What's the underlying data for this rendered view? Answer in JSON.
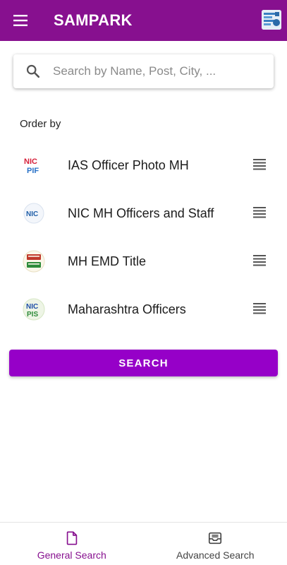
{
  "header": {
    "title": "SAMPARK",
    "menu_icon": "hamburger-menu-icon",
    "logo_icon": "sampark-logo-icon",
    "background_color": "#87108f"
  },
  "search": {
    "placeholder": "Search by Name, Post, City, ...",
    "value": "",
    "icon": "search-icon"
  },
  "order": {
    "label": "Order by",
    "items": [
      {
        "label": "IAS Officer Photo MH",
        "icon": "nic-pif-logo-icon"
      },
      {
        "label": "NIC MH Officers and Staff",
        "icon": "nic-logo-icon"
      },
      {
        "label": "MH EMD Title",
        "icon": "mahapar-logo-icon"
      },
      {
        "label": "Maharashtra Officers",
        "icon": "nic-pis-logo-icon"
      }
    ],
    "handle_icon": "drag-handle-icon"
  },
  "search_button": {
    "label": "SEARCH",
    "color": "#9600c8"
  },
  "bottom_nav": {
    "items": [
      {
        "label": "General Search",
        "icon": "document-icon",
        "active": true
      },
      {
        "label": "Advanced Search",
        "icon": "inbox-tray-icon",
        "active": false
      }
    ],
    "active_color": "#87108f"
  }
}
